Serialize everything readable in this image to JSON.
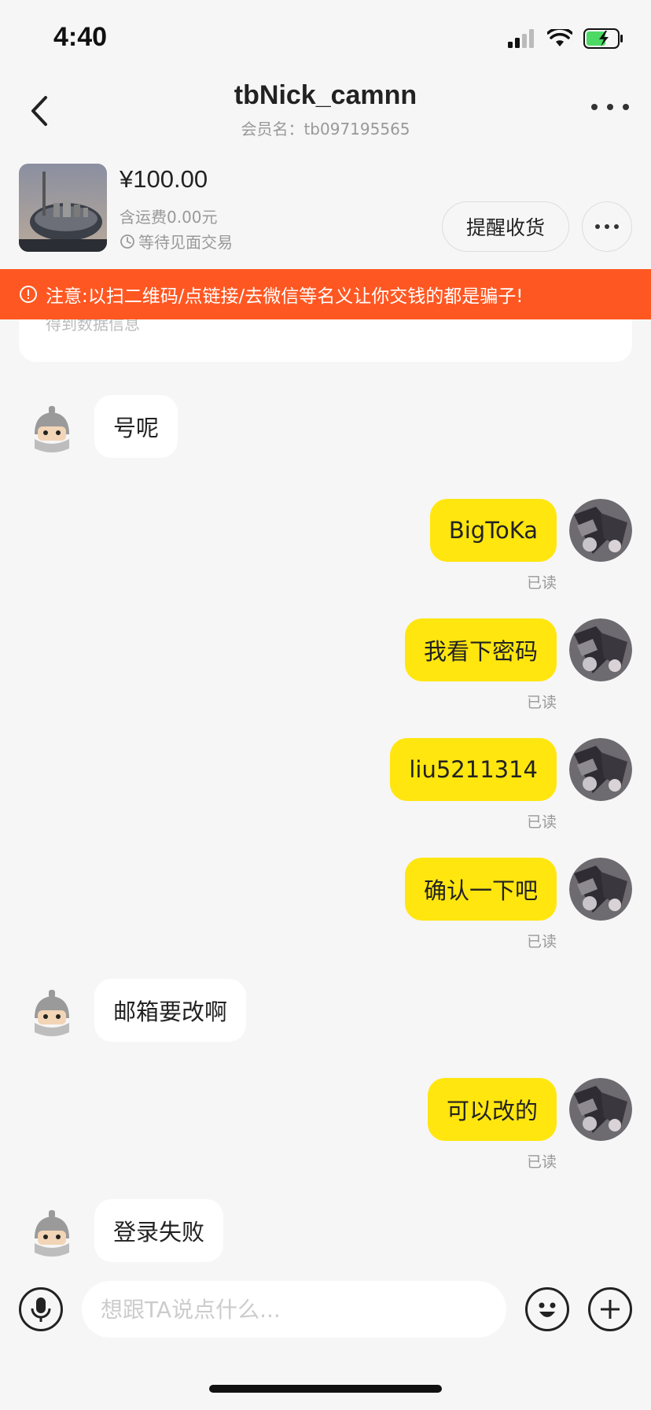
{
  "status_bar": {
    "time": "4:40",
    "battery_color": "#4cd964"
  },
  "header": {
    "title": "tbNick_camnn",
    "subtitle": "会员名：tb097195565"
  },
  "product": {
    "price": "¥100.00",
    "shipping": "含运费0.00元",
    "status": "等待见面交易",
    "remind_label": "提醒收货"
  },
  "warning": {
    "text": "注意:以扫二维码/点链接/去微信等名义让你交钱的都是骗子!",
    "color": "#ff5722"
  },
  "hidden_card": {
    "text": "得到数据信息"
  },
  "messages": [
    {
      "sender": "other",
      "text": "号呢"
    },
    {
      "sender": "me",
      "text": "BigToKa",
      "status": "已读"
    },
    {
      "sender": "me",
      "text": "我看下密码",
      "status": "已读"
    },
    {
      "sender": "me",
      "text": "liu5211314",
      "status": "已读"
    },
    {
      "sender": "me",
      "text": "确认一下吧",
      "status": "已读"
    },
    {
      "sender": "other",
      "text": "邮箱要改啊"
    },
    {
      "sender": "me",
      "text": "可以改的",
      "status": "已读"
    },
    {
      "sender": "other",
      "text": "登录失败"
    }
  ],
  "input": {
    "placeholder": "想跟TA说点什么..."
  },
  "colors": {
    "my_bubble": "#ffe60f",
    "other_bubble": "#ffffff",
    "background": "#f6f6f6"
  }
}
